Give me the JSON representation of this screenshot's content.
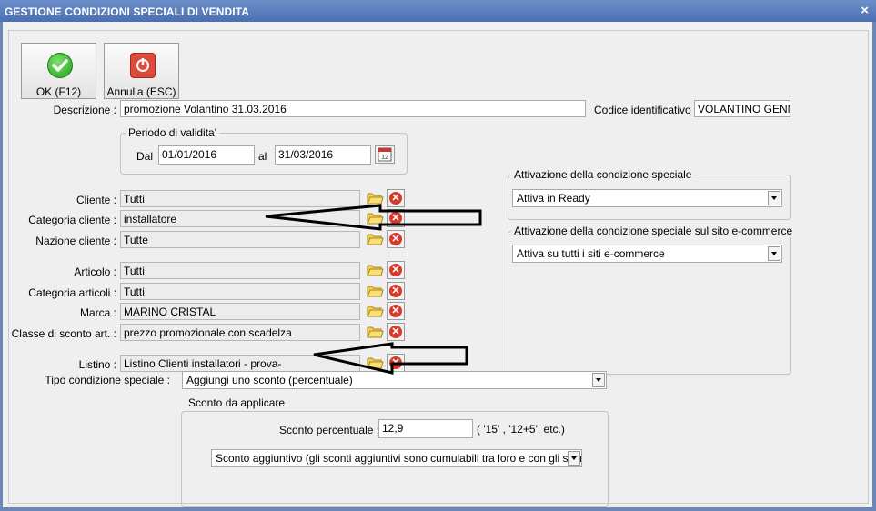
{
  "window": {
    "title": "GESTIONE CONDIZIONI SPECIALI DI VENDITA",
    "close_glyph": "×"
  },
  "toolbar": {
    "ok_label": "OK (F12)",
    "cancel_label": "Annulla (ESC)"
  },
  "descrizione": {
    "label": "Descrizione :",
    "value": "promozione Volantino 31.03.2016"
  },
  "codice": {
    "label": "Codice identificativo :",
    "value": "VOLANTINO GENNAI"
  },
  "periodo": {
    "title": "Periodo di validita'",
    "dal_label": "Dal",
    "dal_value": "01/01/2016",
    "al_label": "al",
    "al_value": "31/03/2016",
    "calendar_glyph": "12"
  },
  "fields": [
    {
      "label": "Cliente :",
      "value": "Tutti"
    },
    {
      "label": "Categoria cliente :",
      "value": "installatore"
    },
    {
      "label": "Nazione cliente :",
      "value": "Tutte"
    },
    {
      "label": "Articolo :",
      "value": "Tutti"
    },
    {
      "label": "Categoria articoli :",
      "value": "Tutti"
    },
    {
      "label": "Marca :",
      "value": "MARINO CRISTAL"
    },
    {
      "label": "Classe di sconto art. :",
      "value": "prezzo promozionale con scadelza"
    },
    {
      "label": "Listino :",
      "value": "Listino Clienti installatori - prova-"
    }
  ],
  "delete_glyph": "✕",
  "attivazione": {
    "title": "Attivazione della condizione speciale",
    "value": "Attiva in Ready"
  },
  "attivazione_sito": {
    "title": "Attivazione della condizione speciale sul sito e-commerce",
    "value": "Attiva su tutti i siti e-commerce"
  },
  "tipo": {
    "label": "Tipo condizione speciale :",
    "value": "Aggiungi uno sconto (percentuale)"
  },
  "sconto": {
    "title": "Sconto da applicare",
    "percent_label": "Sconto percentuale :",
    "percent_value": "12,9",
    "hint": "( '15' ,  '12+5', etc.)",
    "type_value": "Sconto aggiuntivo (gli sconti aggiuntivi sono cumulabili tra loro e con gli sconti prir"
  },
  "colors": {
    "title_bar": "#5a7dbd",
    "delete_red": "#d83a2a",
    "ok_green": "#23a11c"
  }
}
